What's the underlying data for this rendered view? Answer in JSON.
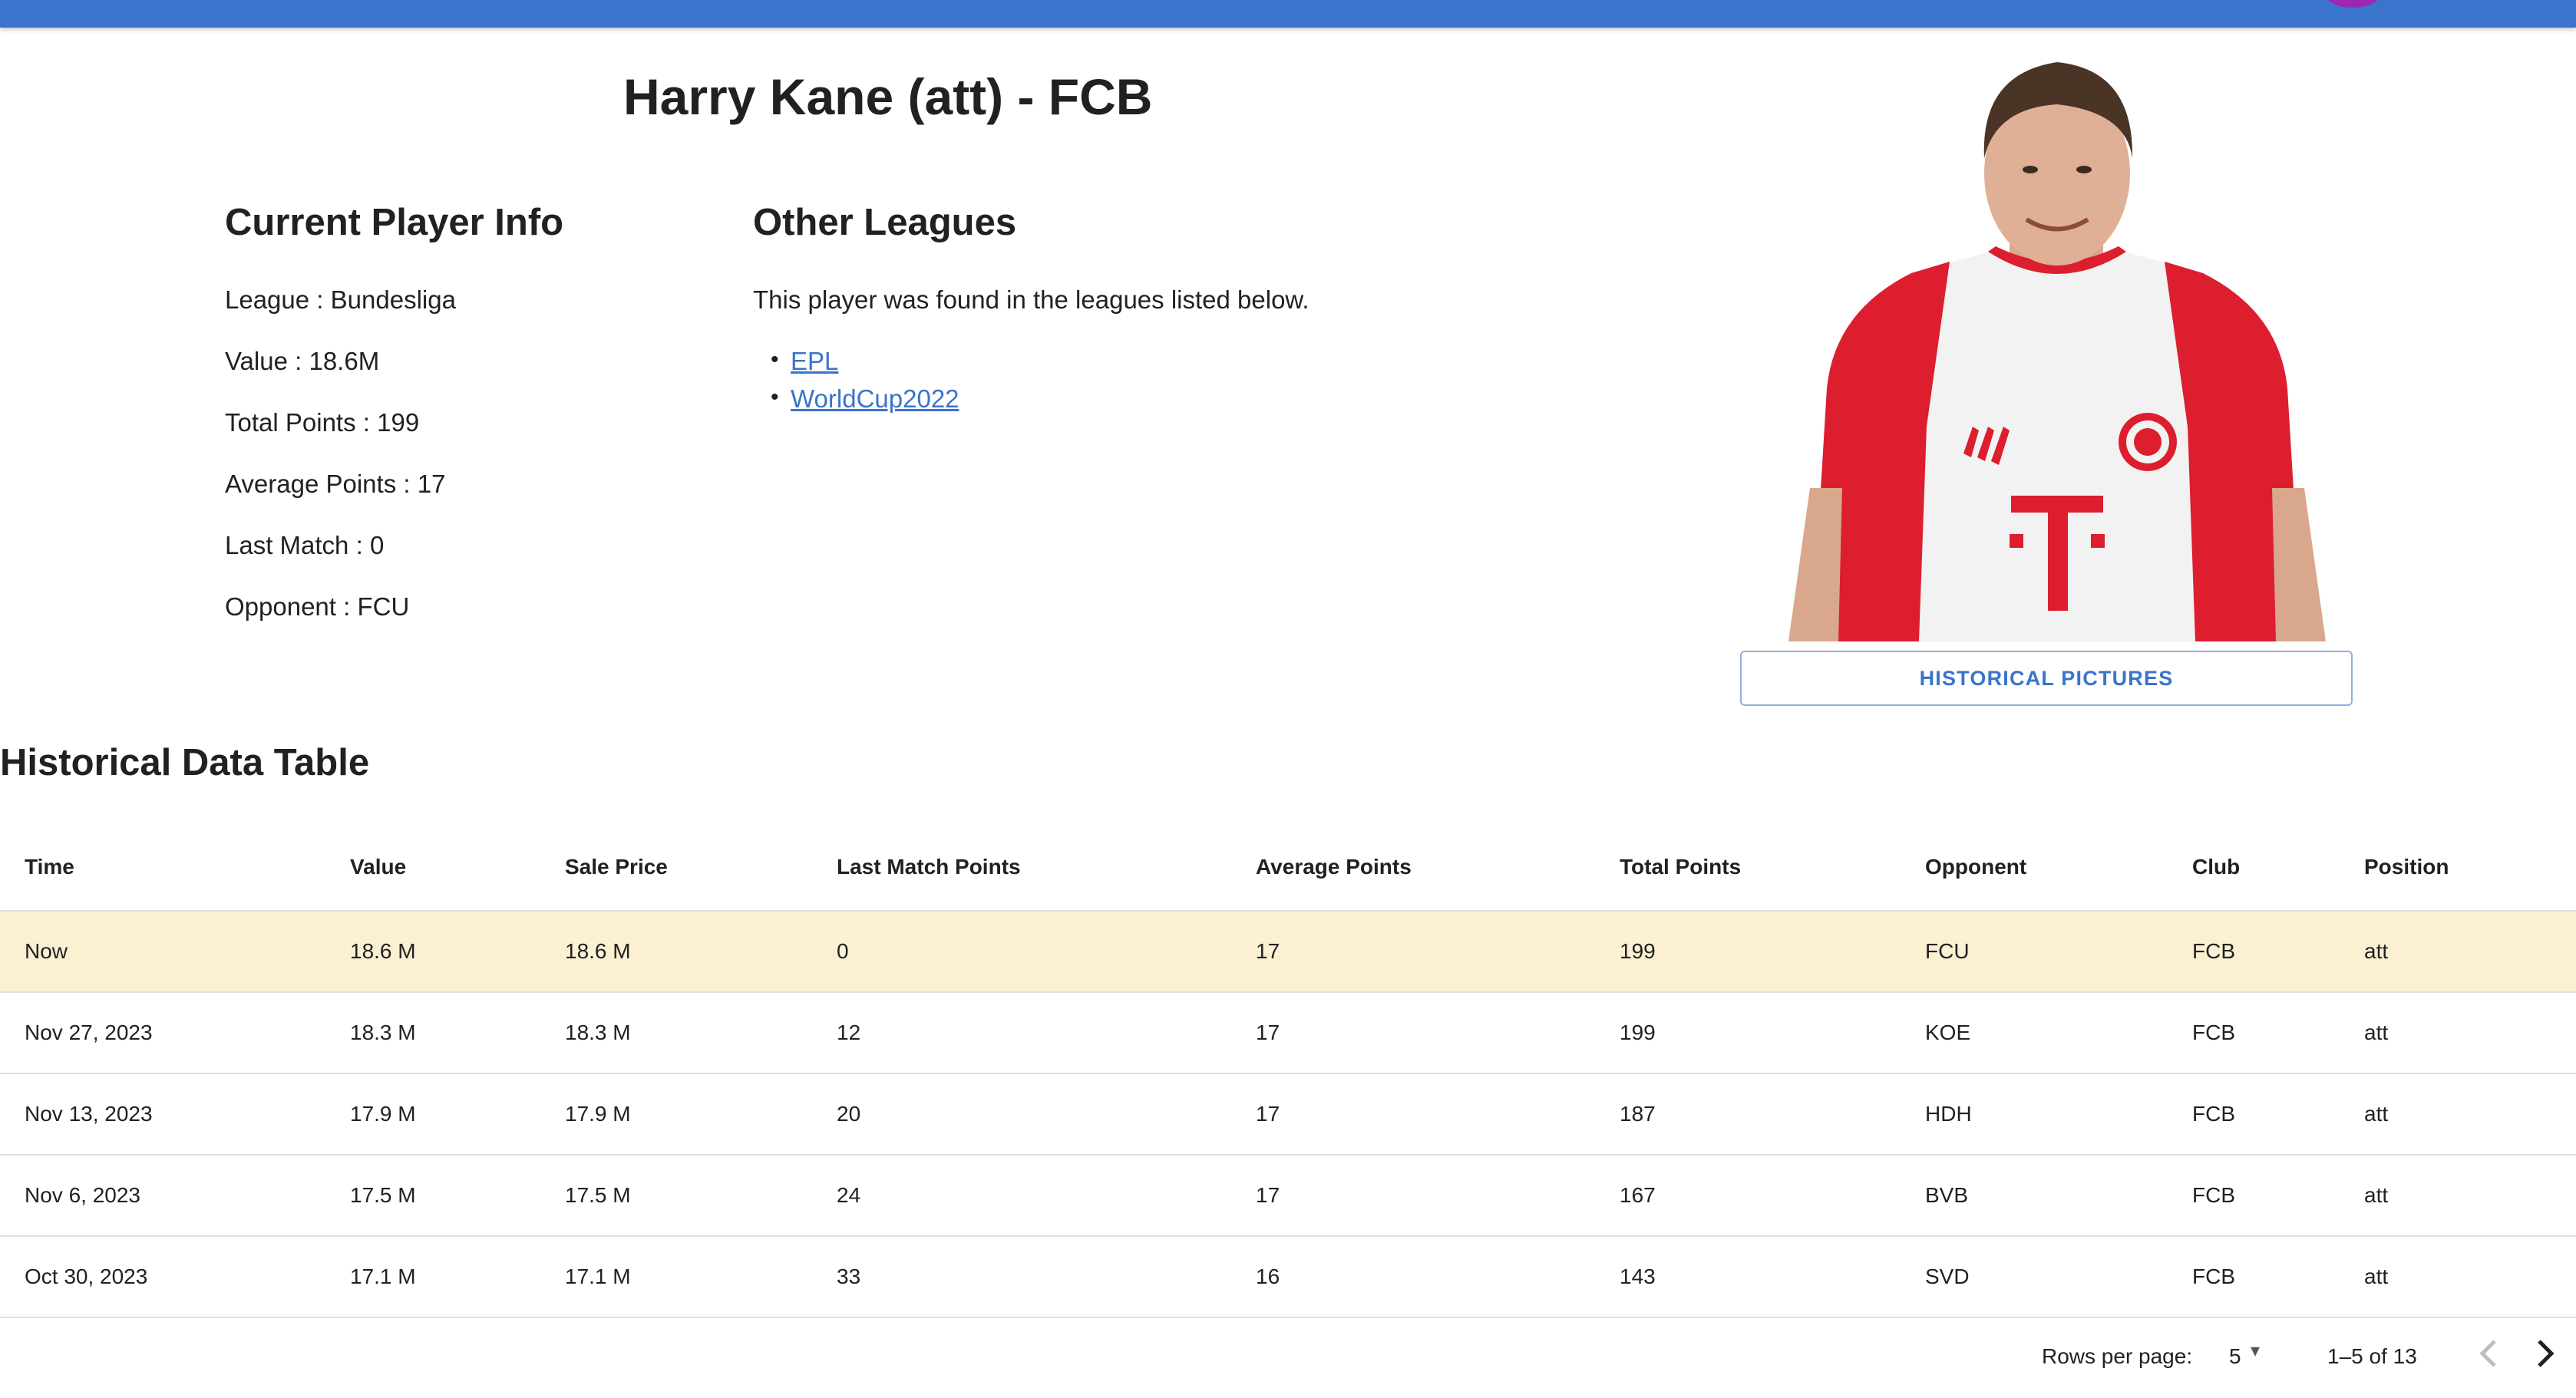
{
  "title": "Harry Kane (att) - FCB",
  "current_info": {
    "heading": "Current Player Info",
    "separator": " : ",
    "fields": [
      {
        "label": "League",
        "value": "Bundesliga"
      },
      {
        "label": "Value",
        "value": "18.6M"
      },
      {
        "label": "Total Points",
        "value": "199"
      },
      {
        "label": "Average Points",
        "value": "17"
      },
      {
        "label": "Last Match",
        "value": "0"
      },
      {
        "label": "Opponent",
        "value": "FCU"
      }
    ]
  },
  "other_leagues": {
    "heading": "Other Leagues",
    "description": "This player was found in the leagues listed below.",
    "leagues": [
      "EPL",
      "WorldCup2022"
    ]
  },
  "historical_pictures_button": "HISTORICAL PICTURES",
  "table": {
    "title": "Historical Data Table",
    "columns": [
      "Time",
      "Value",
      "Sale Price",
      "Last Match Points",
      "Average Points",
      "Total Points",
      "Opponent",
      "Club",
      "Position"
    ],
    "rows": [
      [
        "Now",
        "18.6 M",
        "18.6 M",
        "0",
        "17",
        "199",
        "FCU",
        "FCB",
        "att"
      ],
      [
        "Nov 27, 2023",
        "18.3 M",
        "18.3 M",
        "12",
        "17",
        "199",
        "KOE",
        "FCB",
        "att"
      ],
      [
        "Nov 13, 2023",
        "17.9 M",
        "17.9 M",
        "20",
        "17",
        "187",
        "HDH",
        "FCB",
        "att"
      ],
      [
        "Nov 6, 2023",
        "17.5 M",
        "17.5 M",
        "24",
        "17",
        "167",
        "BVB",
        "FCB",
        "att"
      ],
      [
        "Oct 30, 2023",
        "17.1 M",
        "17.1 M",
        "33",
        "16",
        "143",
        "SVD",
        "FCB",
        "att"
      ]
    ]
  },
  "pagination": {
    "rows_per_page_label": "Rows per page:",
    "rows_per_page": "5",
    "range": "1–5 of 13"
  },
  "colors": {
    "app_bar": "#3a74cc",
    "highlight_row": "#fbf0d1",
    "link": "#3a74cc",
    "jersey_red": "#dc1e2f"
  }
}
